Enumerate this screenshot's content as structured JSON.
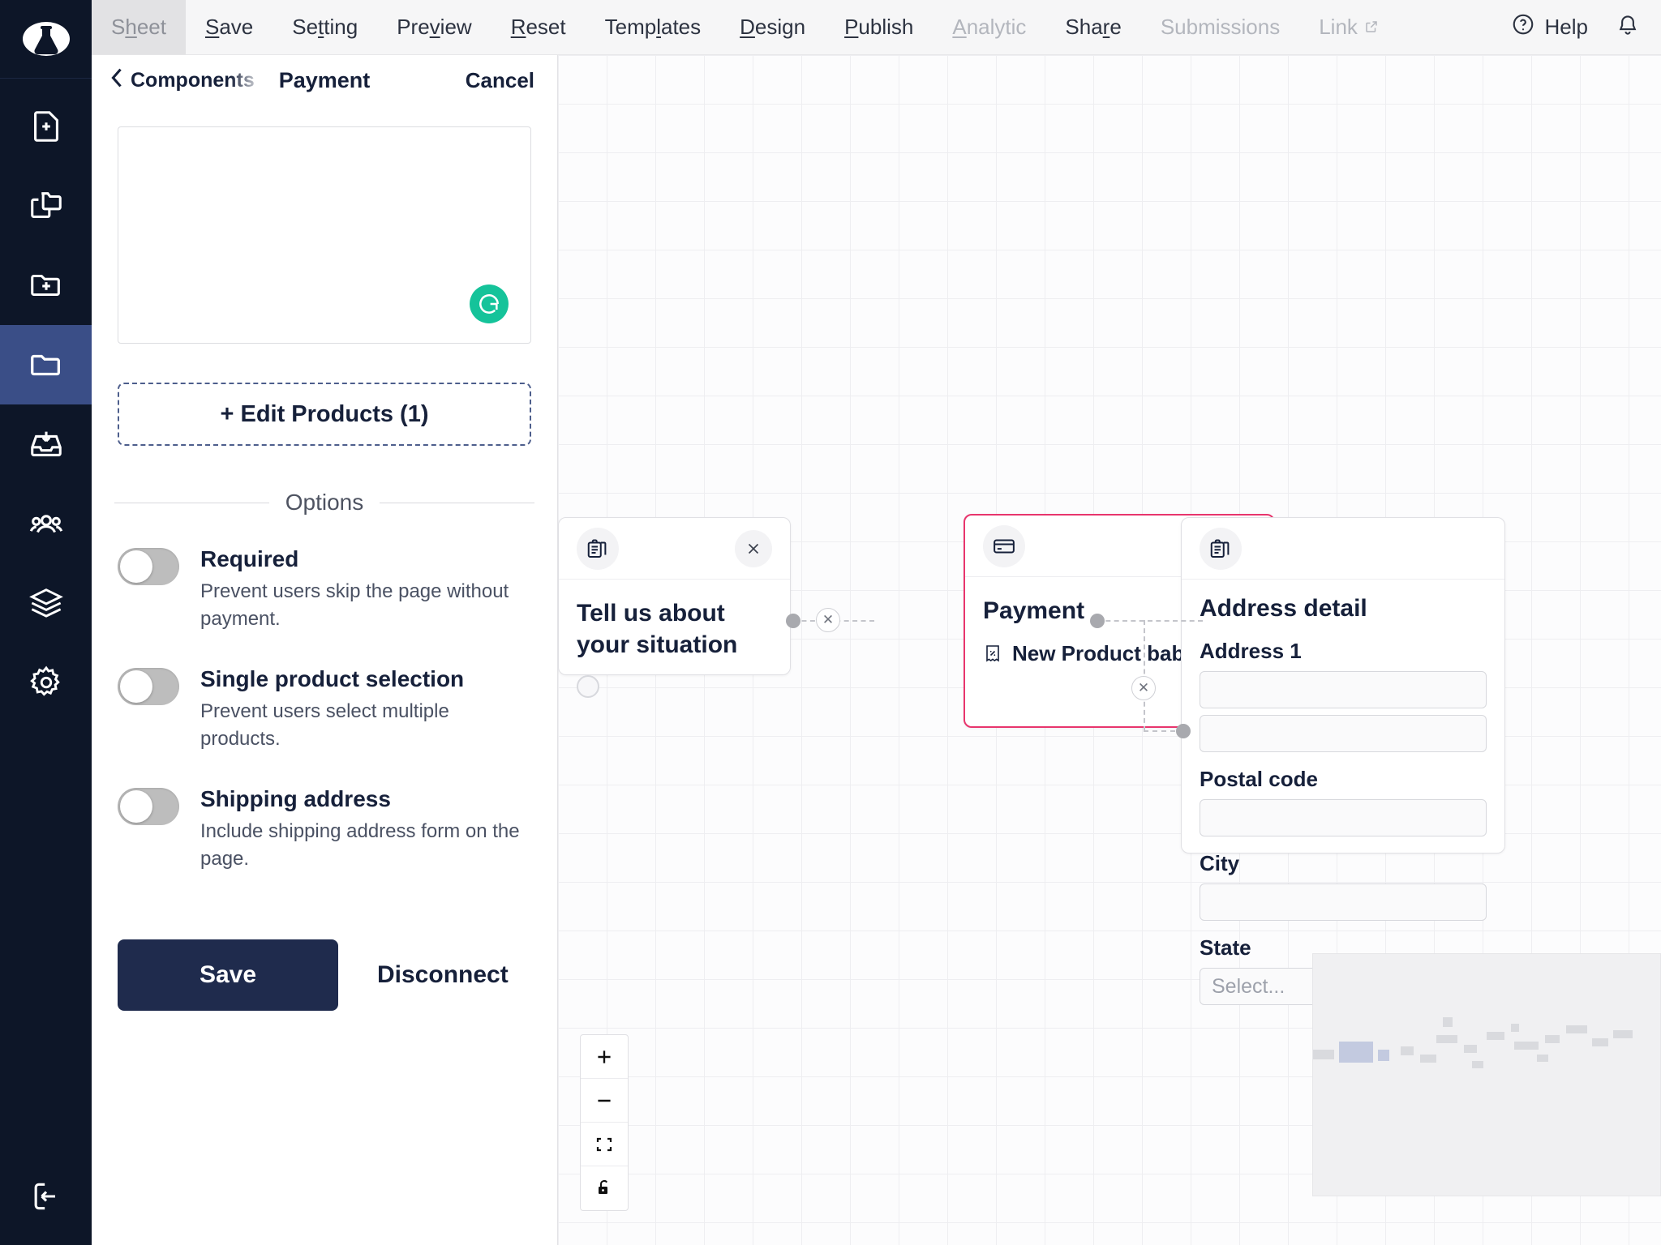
{
  "app": {
    "logo_icon": "flask-logo-icon",
    "accent_navy": "#0d1628",
    "accent_active": "#3a4e87",
    "accent_selected_node": "#e8356d",
    "accent_button": "#1f2b4d",
    "accent_green": "#15c39a"
  },
  "sidebar": {
    "items": [
      {
        "icon": "new-file-icon",
        "name": "sidebar-item-new-file",
        "active": false
      },
      {
        "icon": "duplicate-icon",
        "name": "sidebar-item-duplicate",
        "active": false
      },
      {
        "icon": "new-folder-icon",
        "name": "sidebar-item-new-folder",
        "active": false
      },
      {
        "icon": "folder-icon",
        "name": "sidebar-item-folder",
        "active": true
      },
      {
        "icon": "inbox-download-icon",
        "name": "sidebar-item-inbox",
        "active": false
      },
      {
        "icon": "users-icon",
        "name": "sidebar-item-users",
        "active": false
      },
      {
        "icon": "layers-icon",
        "name": "sidebar-item-layers",
        "active": false
      },
      {
        "icon": "gear-icon",
        "name": "sidebar-item-settings",
        "active": false
      }
    ],
    "bottom_item": {
      "icon": "logout-icon",
      "name": "sidebar-item-logout"
    }
  },
  "topbar": {
    "menu": [
      {
        "label": "Sheet",
        "pre": "S",
        "acc": "h",
        "post": "eet",
        "state": "selected"
      },
      {
        "label": "Save",
        "pre": "",
        "acc": "S",
        "post": "ave",
        "state": "normal"
      },
      {
        "label": "Setting",
        "pre": "Se",
        "acc": "t",
        "post": "ting",
        "state": "normal"
      },
      {
        "label": "Preview",
        "pre": "Pre",
        "acc": "v",
        "post": "iew",
        "state": "normal"
      },
      {
        "label": "Reset",
        "pre": "",
        "acc": "R",
        "post": "eset",
        "state": "normal"
      },
      {
        "label": "Templates",
        "pre": "Temp",
        "acc": "l",
        "post": "ates",
        "state": "normal"
      },
      {
        "label": "Design",
        "pre": "",
        "acc": "D",
        "post": "esign",
        "state": "normal"
      },
      {
        "label": "Publish",
        "pre": "",
        "acc": "P",
        "post": "ublish",
        "state": "normal"
      },
      {
        "label": "Analytic",
        "pre": "",
        "acc": "A",
        "post": "nalytic",
        "state": "disabled"
      },
      {
        "label": "Share",
        "pre": "Sha",
        "acc": "r",
        "post": "e",
        "state": "normal"
      },
      {
        "label": "Submissions",
        "pre": "Submissions",
        "acc": "",
        "post": "",
        "state": "disabled"
      },
      {
        "label": "Link",
        "pre": "Link",
        "acc": "",
        "post": "",
        "state": "disabled",
        "external": true
      }
    ],
    "help_label": "Help",
    "help_icon": "question-circle-icon",
    "notification_icon": "bell-icon"
  },
  "panel": {
    "back_label": "Components",
    "back_icon": "chevron-left-icon",
    "title": "Payment",
    "cancel_label": "Cancel",
    "grammarly_icon": "grammarly-refresh-icon",
    "edit_products_label": "+ Edit Products (1)",
    "options_divider_label": "Options",
    "options": [
      {
        "title": "Required",
        "desc": "Prevent users skip the page without payment.",
        "enabled": false,
        "name": "toggle-required"
      },
      {
        "title": "Single product selection",
        "desc": "Prevent users select multiple products.",
        "enabled": false,
        "name": "toggle-single-product-selection"
      },
      {
        "title": "Shipping address",
        "desc": "Include shipping address form on the page.",
        "enabled": false,
        "name": "toggle-shipping-address"
      }
    ],
    "save_label": "Save",
    "disconnect_label": "Disconnect"
  },
  "canvas": {
    "nodes": [
      {
        "id": "node-tell-us",
        "icon": "clipboard-list-icon",
        "title": "Tell us about your situation",
        "selected": false,
        "close_icon": "close-icon"
      },
      {
        "id": "node-payment",
        "icon": "credit-card-icon",
        "title": "Payment",
        "item_icon": "receipt-percent-icon",
        "item_label": "New Product baby data",
        "selected": true,
        "close_icon": "close-icon"
      },
      {
        "id": "node-address-detail",
        "icon": "clipboard-list-icon",
        "title": "Address detail",
        "selected": false,
        "fields": [
          {
            "label": "Address 1",
            "value": "",
            "placeholder": ""
          },
          {
            "label": "",
            "value": "",
            "placeholder": ""
          },
          {
            "label": "Postal code",
            "value": "",
            "placeholder": ""
          },
          {
            "label": "City",
            "value": "",
            "placeholder": ""
          },
          {
            "label": "State",
            "value": "",
            "placeholder": "Select..."
          }
        ]
      }
    ],
    "edge_remove_icon": "edge-remove-icon",
    "controls": [
      {
        "icon": "zoom-in-icon",
        "name": "zoom-in-button"
      },
      {
        "icon": "zoom-out-icon",
        "name": "zoom-out-button"
      },
      {
        "icon": "fit-view-icon",
        "name": "fit-view-button"
      },
      {
        "icon": "lock-icon",
        "name": "lock-canvas-button"
      }
    ]
  }
}
